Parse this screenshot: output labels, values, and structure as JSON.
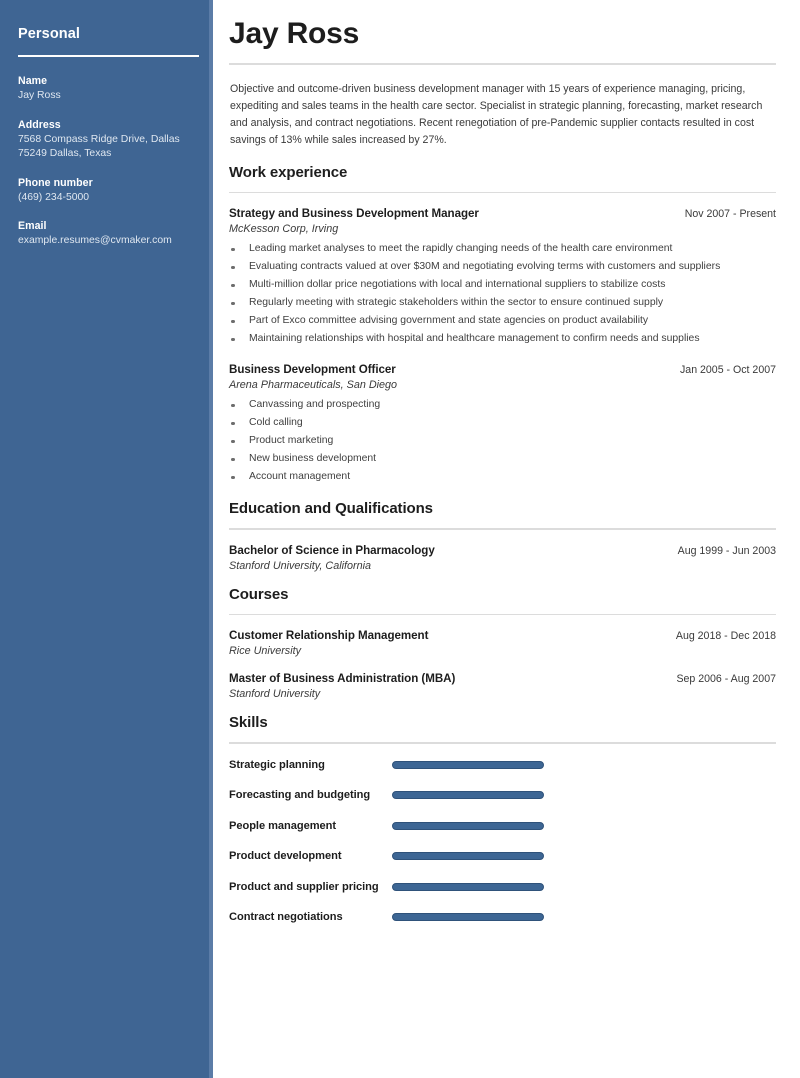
{
  "sidebar": {
    "title": "Personal",
    "fields": [
      {
        "label": "Name",
        "value": "Jay Ross"
      },
      {
        "label": "Address",
        "value": "7568 Compass Ridge Drive, Dallas\n75249 Dallas, Texas"
      },
      {
        "label": "Phone number",
        "value": "(469) 234-5000"
      },
      {
        "label": "Email",
        "value": "example.resumes@cvmaker.com"
      }
    ],
    "background_color": "#3f6593",
    "edge_color": "#5b7ca7"
  },
  "header": {
    "name": "Jay Ross",
    "objective": "Objective and outcome-driven business development manager with 15 years of experience managing, pricing, expediting and sales teams in the health care sector. Specialist in strategic planning, forecasting, market research and analysis, and contract negotiations. Recent renegotiation of pre-Pandemic supplier contacts resulted in cost savings of 13% while sales increased by 27%."
  },
  "sections": {
    "work": {
      "heading": "Work experience",
      "entries": [
        {
          "title": "Strategy and Business Development Manager",
          "date": "Nov 2007 - Present",
          "subtitle": "McKesson Corp, Irving",
          "bullets": [
            "Leading market analyses to meet the rapidly changing needs of the health care environment",
            "Evaluating contracts valued at over $30M and negotiating evolving terms with customers and suppliers",
            "Multi-million dollar price negotiations with local and international suppliers to stabilize costs",
            "Regularly meeting with strategic stakeholders within the sector to ensure continued supply",
            "Part of Exco committee advising government and state agencies on product availability",
            "Maintaining relationships with hospital and healthcare management to confirm needs and supplies"
          ]
        },
        {
          "title": "Business Development Officer",
          "date": "Jan 2005 - Oct 2007",
          "subtitle": "Arena Pharmaceuticals, San Diego",
          "bullets": [
            "Canvassing and prospecting",
            "Cold calling",
            "Product marketing",
            "New business development",
            "Account management"
          ]
        }
      ]
    },
    "education": {
      "heading": "Education and Qualifications",
      "entries": [
        {
          "title": "Bachelor of Science in Pharmacology",
          "date": "Aug 1999 - Jun 2003",
          "subtitle": "Stanford University, California"
        }
      ]
    },
    "courses": {
      "heading": "Courses",
      "entries": [
        {
          "title": "Customer Relationship Management",
          "date": "Aug 2018 - Dec 2018",
          "subtitle": "Rice University"
        },
        {
          "title": "Master of Business Administration (MBA)",
          "date": "Sep 2006 - Aug 2007",
          "subtitle": "Stanford University"
        }
      ]
    },
    "skills": {
      "heading": "Skills",
      "bar_color": "#3d6694",
      "items": [
        {
          "name": "Strategic planning",
          "level": 100
        },
        {
          "name": "Forecasting and budgeting",
          "level": 100
        },
        {
          "name": "People management",
          "level": 100
        },
        {
          "name": "Product development",
          "level": 100
        },
        {
          "name": "Product and supplier pricing",
          "level": 100
        },
        {
          "name": "Contract negotiations",
          "level": 100
        }
      ]
    }
  }
}
